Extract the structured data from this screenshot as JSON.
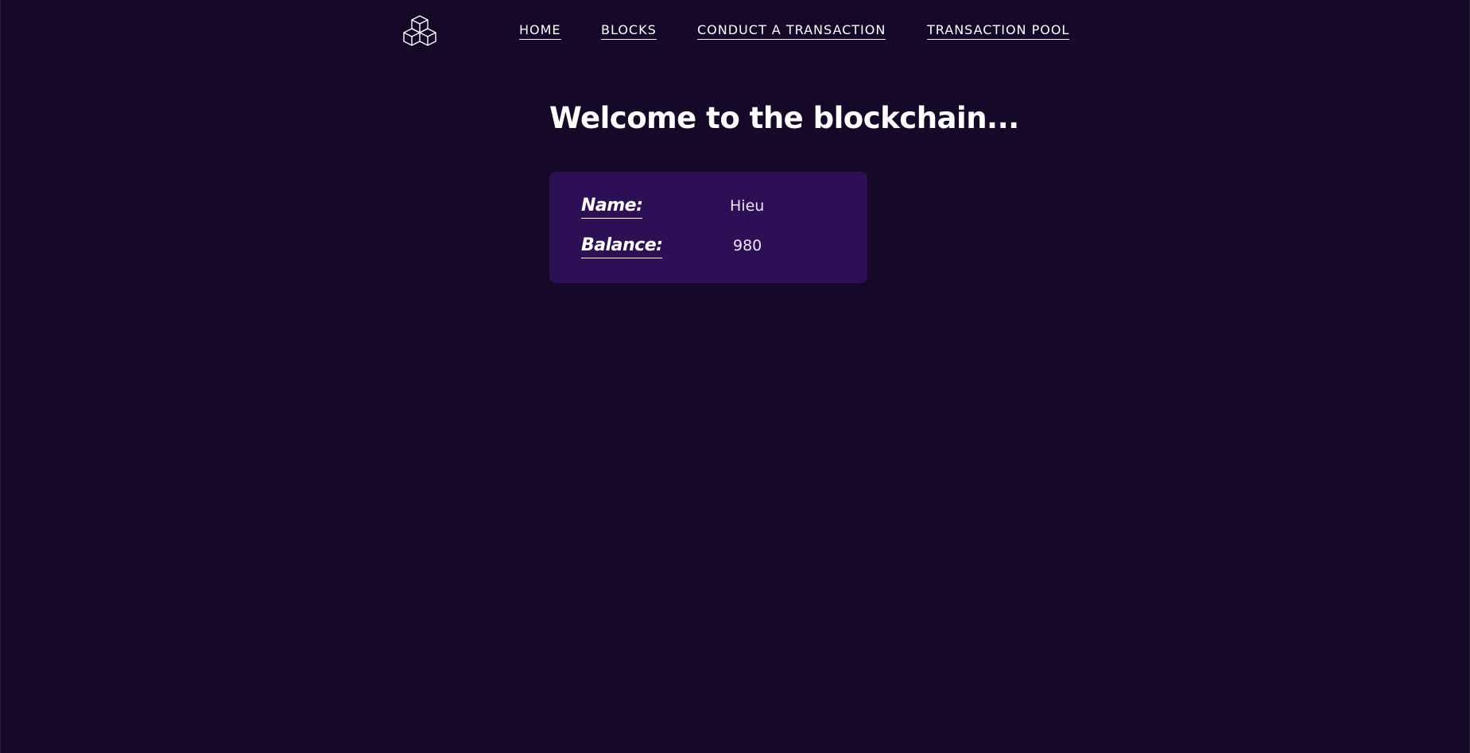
{
  "nav": {
    "logo_icon": "cubes-logo-icon",
    "links": [
      {
        "label": "HOME"
      },
      {
        "label": "BLOCKS"
      },
      {
        "label": "CONDUCT A TRANSACTION"
      },
      {
        "label": "TRANSACTION POOL"
      }
    ]
  },
  "main": {
    "heading": "Welcome to the blockchain..."
  },
  "wallet": {
    "name_label": "Name:",
    "name_value": "Hieu",
    "balance_label": "Balance:",
    "balance_value": "980"
  },
  "colors": {
    "background": "#150828",
    "card": "#2d0f56",
    "text": "#ffffff"
  }
}
